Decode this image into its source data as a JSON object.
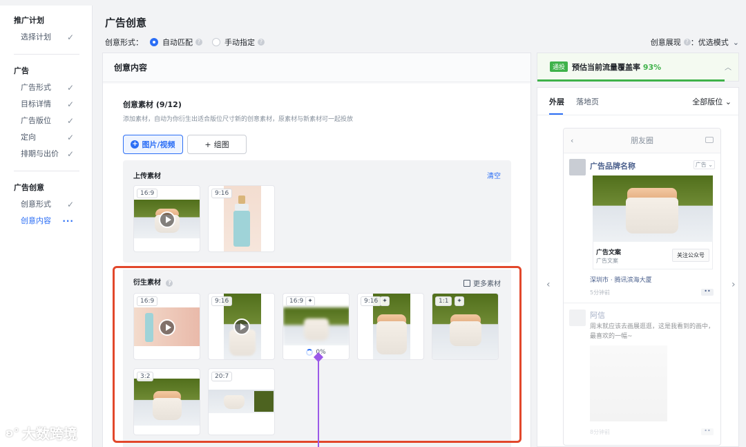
{
  "sidebar": {
    "groups": [
      {
        "title": "推广计划",
        "items": [
          {
            "label": "选择计划",
            "state": "done"
          }
        ]
      },
      {
        "title": "广告",
        "items": [
          {
            "label": "广告形式",
            "state": "done"
          },
          {
            "label": "目标详情",
            "state": "done"
          },
          {
            "label": "广告版位",
            "state": "done"
          },
          {
            "label": "定向",
            "state": "done"
          },
          {
            "label": "排期与出价",
            "state": "done"
          }
        ]
      },
      {
        "title": "广告创意",
        "items": [
          {
            "label": "创意形式",
            "state": "done"
          },
          {
            "label": "创意内容",
            "state": "active"
          }
        ]
      }
    ],
    "check_glyph": "✓",
    "active_glyph": "···"
  },
  "header": {
    "title": "广告创意",
    "form_label": "创意形式：",
    "option_auto": "自动匹配",
    "option_manual": "手动指定",
    "display_mode": "创意展现",
    "display_value": "：优选模式"
  },
  "card": {
    "title": "创意内容",
    "material_title": "创意素材 (9/12)",
    "material_desc": "添加素材，自动为你衍生出适合版位尺寸新的创意素材，原素材与新素材可一起投放",
    "btn_media": "图片/视频",
    "btn_group": "组图",
    "upload": {
      "title": "上传素材",
      "clear": "清空",
      "items": [
        {
          "ratio": "16:9",
          "type": "video"
        },
        {
          "ratio": "9:16",
          "type": "image"
        }
      ]
    },
    "derived": {
      "title": "衍生素材",
      "more": "更多素材",
      "items": [
        {
          "ratio": "16:9",
          "type": "video"
        },
        {
          "ratio": "9:16",
          "type": "video"
        },
        {
          "ratio": "16:9",
          "type": "generating",
          "progress": "0%"
        },
        {
          "ratio": "9:16",
          "type": "ai"
        },
        {
          "ratio": "1:1",
          "type": "ai"
        },
        {
          "ratio": "3:2",
          "type": "image"
        },
        {
          "ratio": "20:7",
          "type": "image"
        }
      ]
    }
  },
  "right": {
    "status_tag": "通投",
    "coverage_label": "预估当前流量覆盖率",
    "coverage_value": "93%",
    "coverage_fraction": 0.93,
    "tabs": [
      "外层",
      "落地页"
    ],
    "placements": "全部版位",
    "preview": {
      "header": "朋友圈",
      "brand": "广告品牌名称",
      "ad_tag": "广告",
      "ad_copy": "广告文案",
      "ad_copy2": "广告文案",
      "follow": "关注公众号",
      "location": "深圳市 · 腾讯滨海大厦",
      "time": "5分钟前",
      "friend_name": "阿信",
      "friend_text": "周末就应该去画展逛逛，这是我看到的画中，最喜欢的一幅~",
      "friend_time": "8分钟前"
    }
  },
  "watermark": "大数跨境",
  "colors": {
    "accent": "#2b6ef5",
    "success": "#3fb24a",
    "highlight": "#e2472b",
    "pointer": "#9b59e8"
  }
}
